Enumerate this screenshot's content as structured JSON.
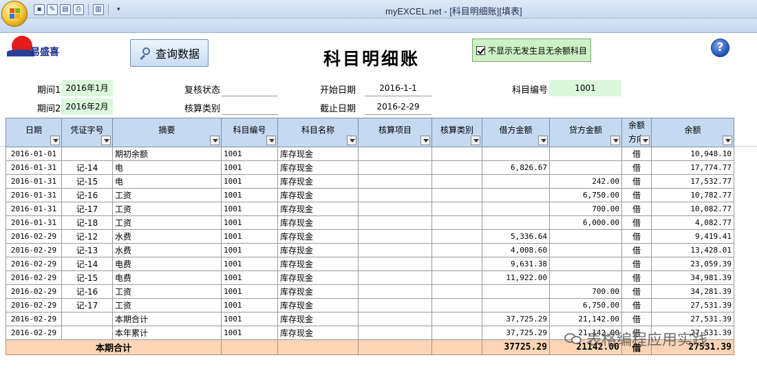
{
  "window": {
    "title": "myEXCEL.net - [科目明细账][填表]"
  },
  "brand": {
    "name": "易盛喜"
  },
  "toolbar": {
    "query_label": "查询数据",
    "page_title": "科目明细账",
    "checkbox_label": "不显示无发生且无余额科目",
    "checkbox_checked": true,
    "help_label": "?"
  },
  "filters": {
    "period1_label": "期间1",
    "period1_value": "2016年1月",
    "period2_label": "期间2",
    "period2_value": "2016年2月",
    "review_label": "复核状态",
    "review_value": "",
    "calc_label": "核算类别",
    "calc_value": "",
    "start_label": "开始日期",
    "start_value": "2016-1-1",
    "end_label": "截止日期",
    "end_value": "2016-2-29",
    "account_label": "科目编号",
    "account_value": "1001"
  },
  "table": {
    "headers": [
      "日期",
      "凭证字号",
      "摘要",
      "科目编号",
      "科目名称",
      "核算项目",
      "核算类别",
      "借方金额",
      "贷方金额",
      "余额方向",
      "余额"
    ],
    "header_display": [
      "日期",
      "凭证字号",
      "摘要",
      "科目编号",
      "科目名称",
      "核算项目",
      "核算类别",
      "借方金额",
      "贷方金额",
      "余额\n方向",
      "余额"
    ],
    "rows": [
      [
        "2016-01-01",
        "",
        "期初余额",
        "1001",
        "库存现金",
        "",
        "",
        "",
        "",
        "借",
        "10,948.10"
      ],
      [
        "2016-01-31",
        "记-14",
        "电",
        "1001",
        "库存现金",
        "",
        "",
        "6,826.67",
        "",
        "借",
        "17,774.77"
      ],
      [
        "2016-01-31",
        "记-15",
        "电",
        "1001",
        "库存现金",
        "",
        "",
        "",
        "242.00",
        "借",
        "17,532.77"
      ],
      [
        "2016-01-31",
        "记-16",
        "工资",
        "1001",
        "库存现金",
        "",
        "",
        "",
        "6,750.00",
        "借",
        "10,782.77"
      ],
      [
        "2016-01-31",
        "记-17",
        "工资",
        "1001",
        "库存现金",
        "",
        "",
        "",
        "700.00",
        "借",
        "10,082.77"
      ],
      [
        "2016-01-31",
        "记-18",
        "工资",
        "1001",
        "库存现金",
        "",
        "",
        "",
        "6,000.00",
        "借",
        "4,082.77"
      ],
      [
        "2016-02-29",
        "记-12",
        "水费",
        "1001",
        "库存现金",
        "",
        "",
        "5,336.64",
        "",
        "借",
        "9,419.41"
      ],
      [
        "2016-02-29",
        "记-13",
        "水费",
        "1001",
        "库存现金",
        "",
        "",
        "4,008.60",
        "",
        "借",
        "13,428.01"
      ],
      [
        "2016-02-29",
        "记-14",
        "电费",
        "1001",
        "库存现金",
        "",
        "",
        "9,631.38",
        "",
        "借",
        "23,059.39"
      ],
      [
        "2016-02-29",
        "记-15",
        "电费",
        "1001",
        "库存现金",
        "",
        "",
        "11,922.00",
        "",
        "借",
        "34,981.39"
      ],
      [
        "2016-02-29",
        "记-16",
        "工资",
        "1001",
        "库存现金",
        "",
        "",
        "",
        "700.00",
        "借",
        "34,281.39"
      ],
      [
        "2016-02-29",
        "记-17",
        "工资",
        "1001",
        "库存现金",
        "",
        "",
        "",
        "6,750.00",
        "借",
        "27,531.39"
      ],
      [
        "2016-02-29",
        "",
        "本期合计",
        "1001",
        "库存现金",
        "",
        "",
        "37,725.29",
        "21,142.00",
        "借",
        "27,531.39"
      ],
      [
        "2016-02-29",
        "",
        "本年累计",
        "1001",
        "库存现金",
        "",
        "",
        "37,725.29",
        "21,142.00",
        "借",
        "27,531.39"
      ]
    ],
    "total_row": {
      "label": "本期合计",
      "debit": "37725.29",
      "credit": "21142.00",
      "direction": "借",
      "balance": "27531.39"
    }
  },
  "watermark": {
    "text": "表格编程应用实践"
  }
}
